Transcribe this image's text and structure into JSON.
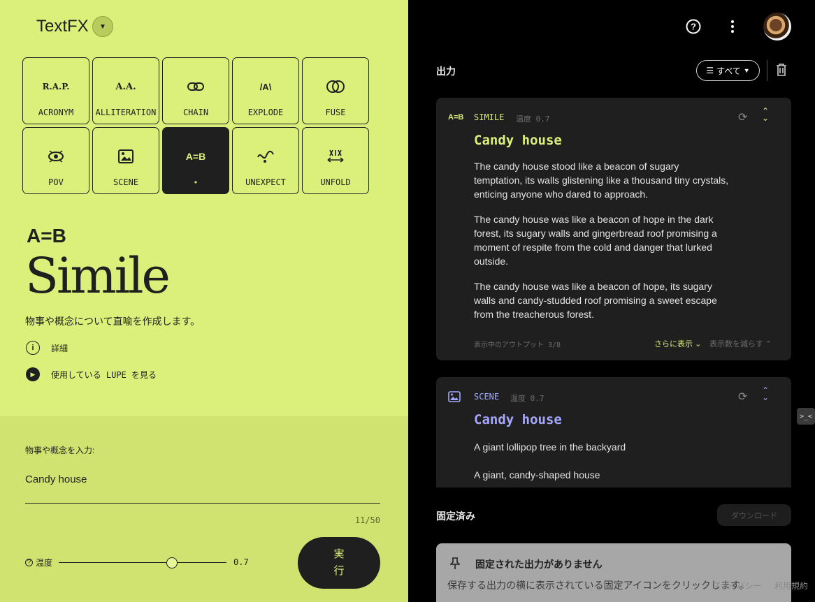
{
  "app": {
    "title": "TextFX"
  },
  "tools": [
    {
      "icon": "R.A.P.",
      "icon_name": "acronym-icon",
      "label": "ACRONYM"
    },
    {
      "icon": "A.A.",
      "icon_name": "alliteration-icon",
      "label": "ALLITERATION"
    },
    {
      "icon": "⛓",
      "icon_name": "chain-icon",
      "label": "CHAIN"
    },
    {
      "icon": "/A\\",
      "icon_name": "explode-icon",
      "label": "EXPLODE"
    },
    {
      "icon": "◐◑",
      "icon_name": "fuse-icon",
      "label": "FUSE"
    },
    {
      "icon": "👁",
      "icon_name": "pov-icon",
      "label": "POV"
    },
    {
      "icon": "🖼",
      "icon_name": "scene-icon",
      "label": "SCENE"
    },
    {
      "icon": "A=B",
      "icon_name": "simile-icon",
      "label": "•",
      "active": true
    },
    {
      "icon": "∿",
      "icon_name": "unexpect-icon",
      "label": "UNEXPECT"
    },
    {
      "icon": "↔",
      "icon_name": "unfold-icon",
      "label": "UNFOLD"
    }
  ],
  "selected": {
    "symbol": "A=B",
    "name": "Simile",
    "description": "物事や概念について直喩を作成します。",
    "details_link": "詳細",
    "lupe_link": "使用している LUPE を見る"
  },
  "input": {
    "label": "物事や概念を入力:",
    "value": "Candy house",
    "counter": "11/50",
    "temp_label": "温度",
    "temp_value": "0.7",
    "temp_fraction": 0.7,
    "run_label_1": "実",
    "run_label_2": "行"
  },
  "output": {
    "title": "出力",
    "filter_label": "すべて"
  },
  "cards": [
    {
      "icon": "A=B",
      "type": "SIMILE",
      "temp": "温度 0.7",
      "heading": "Candy house",
      "color": "#dbf07a",
      "paragraphs": [
        "The candy house stood like a beacon of sugary temptation, its walls glistening like a thousand tiny crystals, enticing anyone who dared to approach.",
        "The candy house was like a beacon of hope in the dark forest, its sugary walls and gingerbread roof promising a moment of respite from the cold and danger that lurked outside.",
        "The candy house was like a beacon of hope, its sugary walls and candy-studded roof promising a sweet escape from the treacherous forest."
      ],
      "shown": "表示中のアウトプット 3/8",
      "more": "さらに表示",
      "less": "表示数を減らす"
    },
    {
      "icon": "🖼",
      "type": "SCENE",
      "temp": "温度 0.7",
      "heading": "Candy house",
      "color": "#a6a8ff",
      "paragraphs": [
        "A giant lollipop tree in the backyard",
        "A giant, candy-shaped house"
      ]
    }
  ],
  "pinned": {
    "title": "固定済み",
    "download": "ダウンロード",
    "empty_title": "固定された出力がありません",
    "empty_sub": "保存する出力の横に表示されている固定アイコンをクリックします。"
  },
  "footer": {
    "privacy": "プライバシー",
    "terms": "利用規約"
  },
  "side_button": ">_<"
}
